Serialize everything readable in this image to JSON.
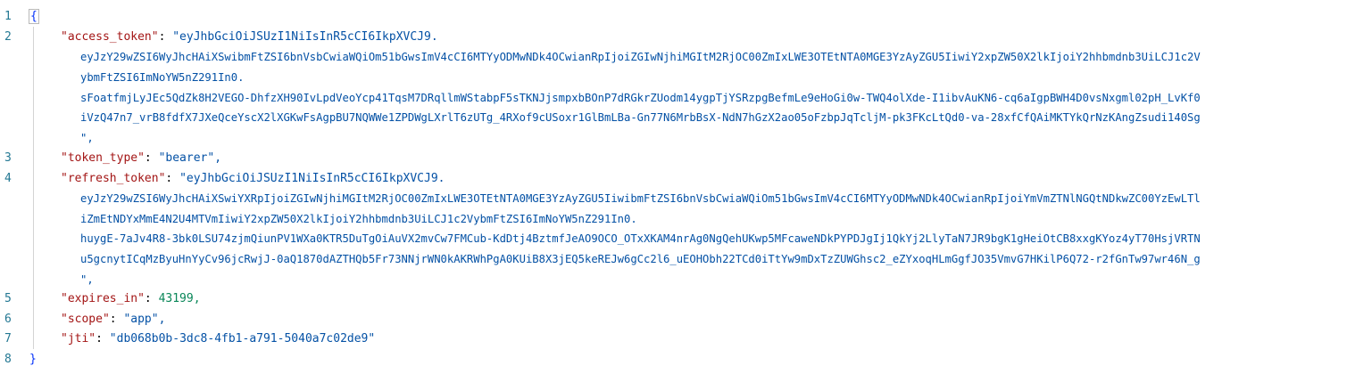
{
  "line_numbers": [
    "1",
    "2",
    "3",
    "4",
    "5",
    "6",
    "7",
    "8"
  ],
  "braces": {
    "open": "{",
    "close": "}"
  },
  "json_entries": [
    {
      "key": "\"access_token\"",
      "first": "\"eyJhbGciOiJSUzI1NiIsInR5cCI6IkpXVCJ9.",
      "cont": [
        "eyJzY29wZSI6WyJhcHAiXSwibmFtZSI6bnVsbCwiaWQiOm51bGwsImV4cCI6MTYyODMwNDk4OCwianRpIjoiZGIwNjhiMGItM2RjOC00ZmIxLWE3OTEtNTA0MGE3YzAyZGU5IiwiY2xpZW50X2lkIjoiY2hhbmdnb3UiLCJ1c2V",
        "ybmFtZSI6ImNoYW5nZ291In0.",
        "sFoatfmjLyJEc5QdZk8H2VEGO-DhfzXH90IvLpdVeoYcp41TqsM7DRqllmWStabpF5sTKNJjsmpxbBOnP7dRGkrZUodm14ygpTjYSRzpgBefmLe9eHoGi0w-TWQ4olXde-I1ibvAuKN6-cq6aIgpBWH4D0vsNxgml02pH_LvKf0",
        "iVzQ47n7_vrB8fdfX7JXeQceYscX2lXGKwFsAgpBU7NQWWe1ZPDWgLXrlT6zUTg_4RXof9cUSoxr1GlBmLBa-Gn77N6MrbBsX-NdN7hGzX2ao05oFzbpJqTcljM-pk3FKcLtQd0-va-28xfCfQAiMKTYkQrNzKAngZsudi140Sg",
        "\","
      ]
    },
    {
      "key": "\"token_type\"",
      "first": "\"bearer\",",
      "cont": []
    },
    {
      "key": "\"refresh_token\"",
      "first": "\"eyJhbGciOiJSUzI1NiIsInR5cCI6IkpXVCJ9.",
      "cont": [
        "eyJzY29wZSI6WyJhcHAiXSwiYXRpIjoiZGIwNjhiMGItM2RjOC00ZmIxLWE3OTEtNTA0MGE3YzAyZGU5IiwibmFtZSI6bnVsbCwiaWQiOm51bGwsImV4cCI6MTYyODMwNDk4OCwianRpIjoiYmVmZTNlNGQtNDkwZC00YzEwLTl",
        "iZmEtNDYxMmE4N2U4MTVmIiwiY2xpZW50X2lkIjoiY2hhbmdnb3UiLCJ1c2VybmFtZSI6ImNoYW5nZ291In0.",
        "huygE-7aJv4R8-3bk0LSU74zjmQiunPV1WXa0KTR5DuTgOiAuVX2mvCw7FMCub-KdDtj4BztmfJeAO9OCO_OTxXKAM4nrAg0NgQehUKwp5MFcaweNDkPYPDJgIj1QkYj2LlyTaN7JR9bgK1gHeiOtCB8xxgKYoz4yT70HsjVRTN",
        "u5gcnytICqMzByuHnYyCv96jcRwjJ-0aQ1870dAZTHQb5Fr73NNjrWN0kAKRWhPgA0KUiB8X3jEQ5keREJw6gCc2l6_uEOHObh22TCd0iTtYw9mDxTzZUWGhsc2_eZYxoqHLmGgfJO35VmvG7HKilP6Q72-r2fGnTw97wr46N_g",
        "\","
      ]
    },
    {
      "key": "\"expires_in\"",
      "first": "43199,",
      "cont": []
    },
    {
      "key": "\"scope\"",
      "first": "\"app\",",
      "cont": []
    },
    {
      "key": "\"jti\"",
      "first": "\"db068b0b-3dc8-4fb1-a791-5040a7c02de9\"",
      "cont": []
    }
  ],
  "colors": {
    "line_number": "#237893",
    "key": "#a31515",
    "string": "#0451a5",
    "number": "#098658",
    "brace": "#0431fa"
  }
}
